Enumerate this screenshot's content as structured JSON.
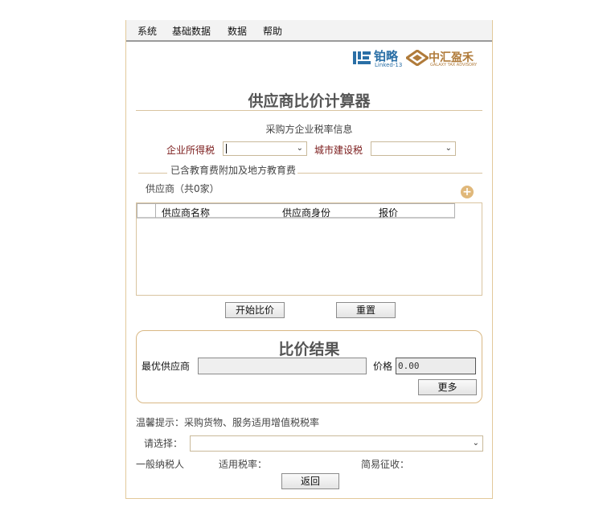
{
  "menu": [
    "系统",
    "基础数据",
    "数据",
    "帮助"
  ],
  "logos": {
    "left_text": "铂略",
    "left_sub": "Linked-13",
    "right_text": "中汇盈禾",
    "right_sub": "GALAXY TAX ADVISORY",
    "left_color": "#2a6fa6",
    "right_color": "#b07b3a"
  },
  "title": "供应商比价计算器",
  "purchaser_section": "采购方企业税率信息",
  "corp_tax_label": "企业所得税",
  "corp_tax_value": "",
  "city_tax_label": "城市建设税",
  "city_tax_value": "",
  "education_fee_note": "已含教育费附加及地方教育费",
  "supplier_count": "供应商（共0家）",
  "add_icon": "plus-circle-icon",
  "table": {
    "columns": [
      "",
      "供应商名称",
      "供应商身份",
      "报价"
    ],
    "rows": []
  },
  "buttons": {
    "start": "开始比价",
    "reset": "重置",
    "more": "更多",
    "back": "返回"
  },
  "result": {
    "title": "比价结果",
    "best_supplier_label": "最优供应商",
    "best_supplier_value": "",
    "price_label": "价格",
    "price_value": "0.00"
  },
  "hint": "温馨提示：采购货物、服务适用增值税税率",
  "choose_label": "请选择：",
  "choose_value": "",
  "general_taxpayer": "一般纳税人",
  "applicable_rate": "适用税率：",
  "simple_levy": "简易征收：",
  "accent_color": "#d9c4a0"
}
